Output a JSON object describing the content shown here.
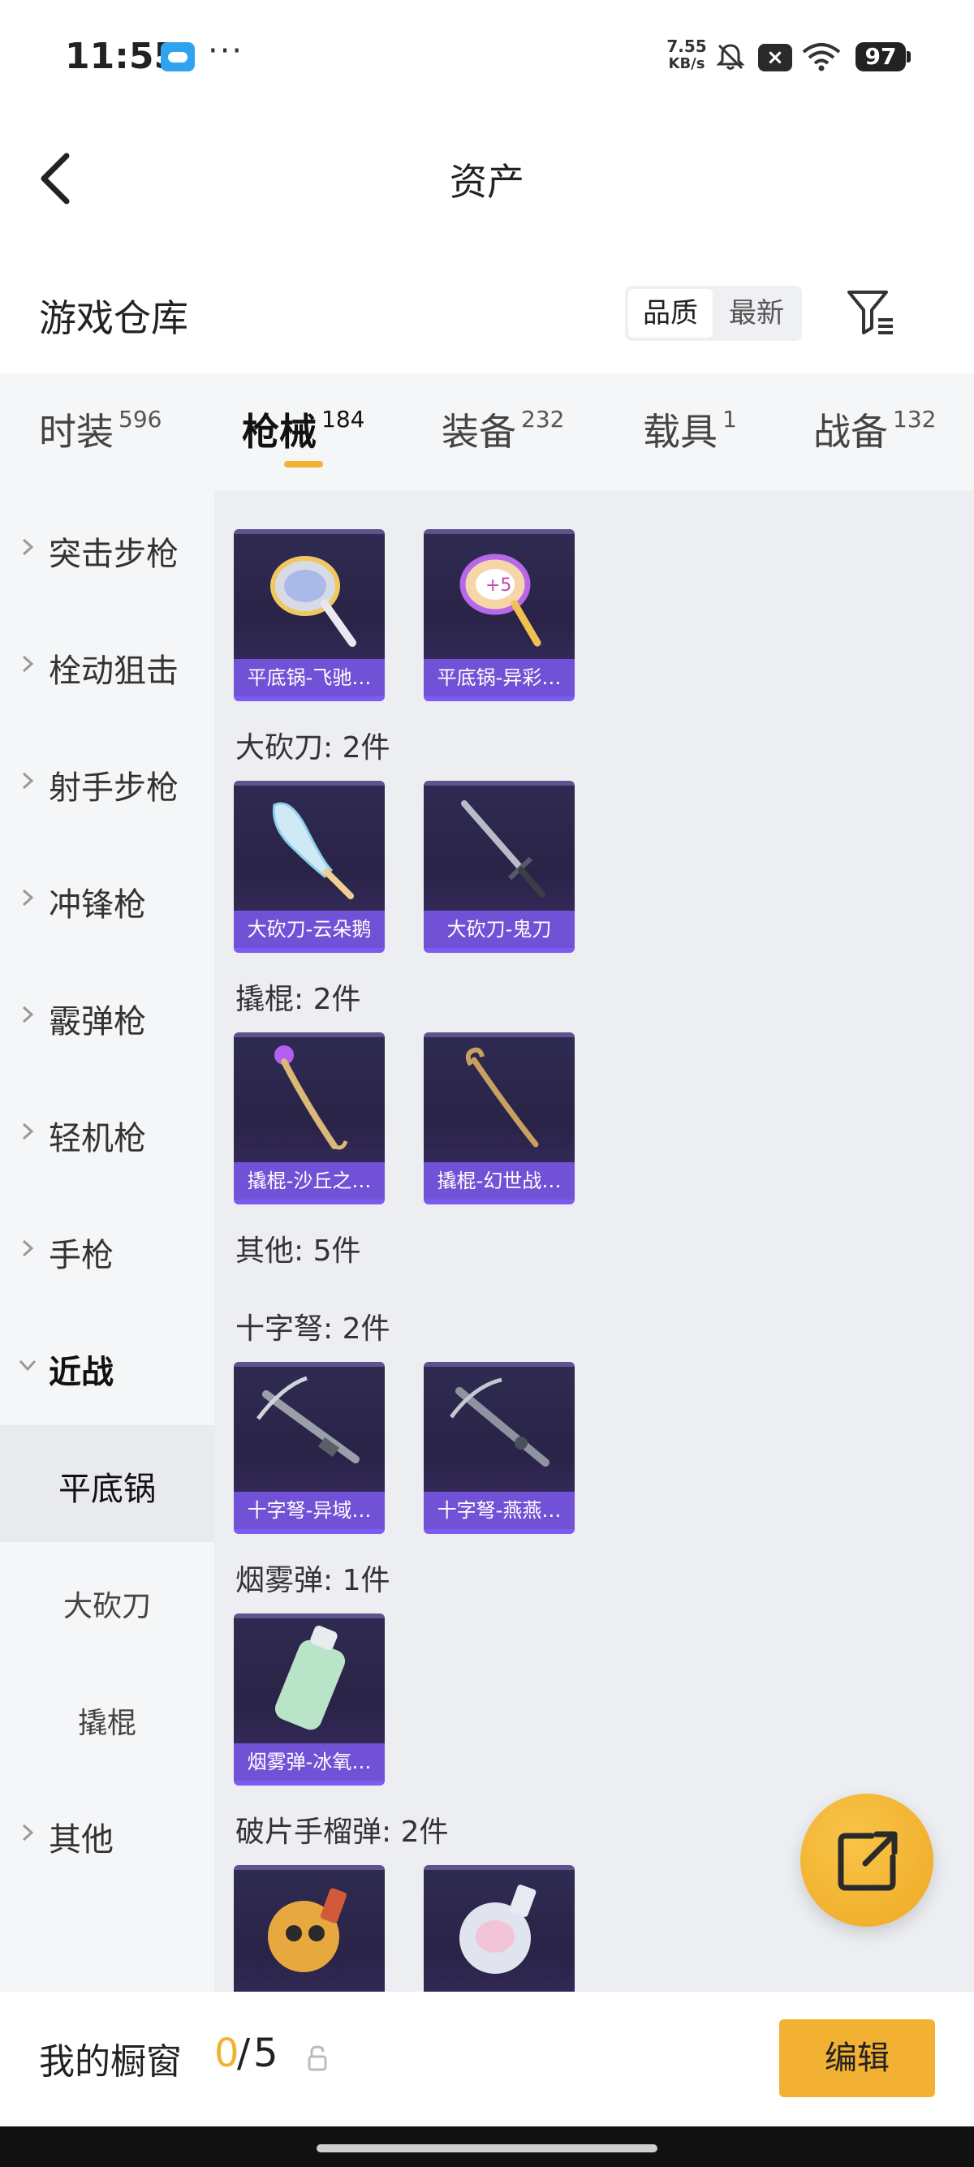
{
  "status_bar": {
    "time": "11:55",
    "net_speed_value": "7.55",
    "net_speed_unit": "KB/s",
    "battery": "97",
    "more": "···"
  },
  "header": {
    "title": "资产"
  },
  "warehouse": {
    "title": "游戏仓库",
    "sort_options": [
      "品质",
      "最新"
    ]
  },
  "tabs": [
    {
      "label": "时装",
      "count": "596"
    },
    {
      "label": "枪械",
      "count": "184"
    },
    {
      "label": "装备",
      "count": "232"
    },
    {
      "label": "载具",
      "count": "1"
    },
    {
      "label": "战备",
      "count": "132"
    }
  ],
  "sidebar": {
    "categories": [
      "突击步枪",
      "栓动狙击",
      "射手步枪",
      "冲锋枪",
      "霰弹枪",
      "轻机枪",
      "手枪",
      "近战"
    ],
    "subcategories": [
      "平底锅",
      "大砍刀",
      "撬棍"
    ],
    "other": "其他"
  },
  "sections": [
    {
      "title": "",
      "items": [
        "平底锅-飞驰…",
        "平底锅-异彩…"
      ]
    },
    {
      "title": "大砍刀: 2件",
      "items": [
        "大砍刀-云朵鹅",
        "大砍刀-鬼刀"
      ]
    },
    {
      "title": "撬棍: 2件",
      "items": [
        "撬棍-沙丘之…",
        "撬棍-幻世战…"
      ]
    },
    {
      "title": "其他: 5件",
      "items": []
    },
    {
      "title": "十字弩: 2件",
      "items": [
        "十字弩-异域…",
        "十字弩-燕燕…"
      ]
    },
    {
      "title": "烟雾弹: 1件",
      "items": [
        "烟雾弹-冰氧…"
      ]
    },
    {
      "title": "破片手榴弹: 2件",
      "items": [
        "",
        ""
      ]
    }
  ],
  "showcase": {
    "label": "我的橱窗",
    "current": "0",
    "sep": "/",
    "max": "5",
    "edit_label": "编辑"
  },
  "colors": {
    "accent": "#f2b132",
    "card_label": "#7152d6",
    "card_bg": "#2a2347"
  }
}
